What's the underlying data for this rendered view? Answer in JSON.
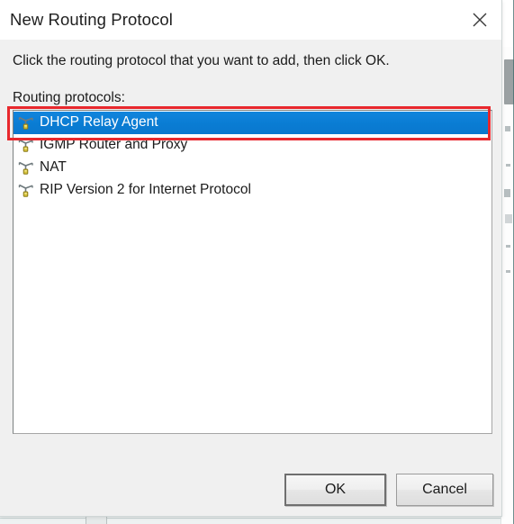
{
  "window": {
    "title": "New Routing Protocol",
    "close_icon": "close-icon"
  },
  "dialog": {
    "instruction": "Click the routing protocol that you want to add, then click OK.",
    "list_label": "Routing protocols:"
  },
  "list": {
    "items": [
      {
        "label": "DHCP Relay Agent",
        "icon": "routing-protocol-icon",
        "selected": true
      },
      {
        "label": "IGMP Router and Proxy",
        "icon": "routing-protocol-icon",
        "selected": false
      },
      {
        "label": "NAT",
        "icon": "routing-protocol-icon",
        "selected": false
      },
      {
        "label": "RIP Version 2 for Internet Protocol",
        "icon": "routing-protocol-icon",
        "selected": false
      }
    ],
    "selected_value": "DHCP Relay Agent",
    "selection_color": "#0a7fd8"
  },
  "annotation": {
    "type": "rectangle-highlight",
    "target": "DHCP Relay Agent",
    "color": "#e8282d"
  },
  "buttons": {
    "ok": "OK",
    "cancel": "Cancel",
    "default_button": "OK"
  }
}
